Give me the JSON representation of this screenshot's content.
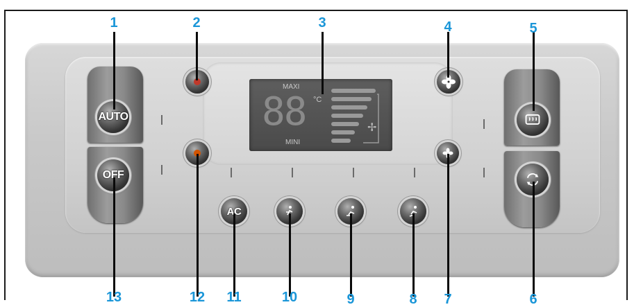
{
  "colors": {
    "callout": "#1a96d8",
    "leader": "#0a0a0a",
    "panel": "#cfcfcf"
  },
  "callouts": {
    "c1": "1",
    "c2": "2",
    "c3": "3",
    "c4": "4",
    "c5": "5",
    "c6": "6",
    "c7": "7",
    "c8": "8",
    "c9": "9",
    "c10": "10",
    "c11": "11",
    "c12": "12",
    "c13": "13"
  },
  "buttons": {
    "auto": "AUTO",
    "off": "OFF",
    "ac": "AC"
  },
  "lcd": {
    "digits": "88",
    "unit": "°C",
    "maxi": "MAXI",
    "mini": "MINI"
  },
  "icons": {
    "b2": "temp-up-icon",
    "b4": "fan-high-icon",
    "b5": "rear-defrost-icon",
    "b6": "recirculation-icon",
    "b7": "fan-low-icon",
    "b8": "airflow-feet-icon",
    "b9": "airflow-face-feet-icon",
    "b10": "airflow-face-icon",
    "b12": "temp-down-icon"
  }
}
